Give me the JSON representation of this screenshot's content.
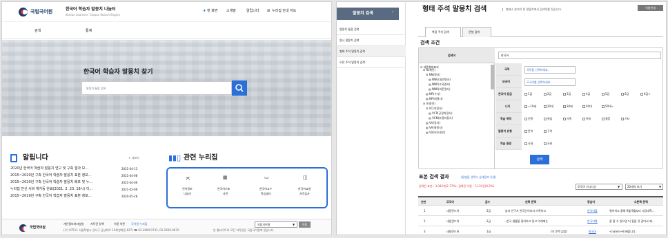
{
  "left": {
    "header": {
      "logo_text": "국립국어원",
      "site_title": "한국어 학습자 말뭉치 나눔터",
      "site_subtitle": "Korean Learners' Corpus Search Engine",
      "links": [
        "첫 화면",
        "소개말",
        "알립니다",
        "누리집 안내 지도"
      ]
    },
    "nav": {
      "items": [
        "검색",
        "통계"
      ]
    },
    "hero": {
      "title": "한국어 학습자 말뭉치 찾기",
      "search_placeholder": "말뭉치 통합 검색"
    },
    "notice": {
      "heading": "알립니다",
      "more": "+ 더보기",
      "items": [
        {
          "title": "2020년 한국어 학습자 말뭉치 연구 및 구축 결과 보...",
          "date": "2021-04-13"
        },
        {
          "title": "2015~2020년 구축 한국어 학습자 말뭉치 표본 정보...",
          "date": "2021-04-08"
        },
        {
          "title": "2015~2020년 구축 한국어 학습자 말뭉치 배포 및 누...",
          "date": "2021-04-06"
        },
        {
          "title": "누리집 전산 서버 재가동 완료(2021. 2. 23. 18시) 이...",
          "date": "2021-02-09"
        },
        {
          "title": "2015~2019년 구축 한국어 학습자 말뭉치 표본 정보...",
          "date": "2020-05-28"
        }
      ]
    },
    "related": {
      "heading": "관련 누리집",
      "tiles": [
        {
          "line1": "언어정보",
          "line2": "나눔터"
        },
        {
          "line1": "한국어기초",
          "line2": "사전"
        },
        {
          "line1": "한국어교수",
          "line2": "학습샘터"
        },
        {
          "line1": "한국어교원",
          "line2": "자격심사"
        }
      ]
    },
    "footer": {
      "logo_text": "국립국어원",
      "links": [
        "개인정보처리방침",
        "저작권 정책",
        "이용 약관",
        "국어원 누리집"
      ],
      "address": "(우) 07511 서울특별시 강서구 금낭화로 154(방화동 827)  ☎ 02-2669-9743, 02-2669-9670",
      "copyright": "본 웹사이트의 모든 저작권은 국립국어원에 있습니다.",
      "select": "국립국어원",
      "go": "이동"
    }
  },
  "right": {
    "sidebar": {
      "head": "말뭉치 검색",
      "items": [
        "말뭉치 통합 검색",
        "원시 말뭉치 검색",
        "형태 주석 말뭉치 검색",
        "오류 주석 말뭉치 검색"
      ]
    },
    "page": {
      "title": "형태 주석 말뭉치 검색",
      "desc": "형태소 분석이 된 말뭉치에서 검색어를 찾습니다.",
      "help": "이용안내"
    },
    "tabs": [
      "복합 주석 검색",
      "문형 검색"
    ],
    "cond": {
      "heading": "검색 조건",
      "keyword_label": "검색어",
      "keyword_value": "한국어",
      "tree": [
        "⊟ 세종형태표지",
        "⊟ N(체언)",
        "⊟ NN(명사)",
        "▤ NNG(일반명사)",
        "▤ NNP(고유명사)",
        "▤ NNB(의존명사)",
        "▤ NR(수사)",
        "▤ NP(대명사)",
        "⊟ V(용언)",
        "⊟ VC(지정사)",
        "▤ VCP(긍정지정사)",
        "▤ VCN(부정지정사)",
        "▤ VV(동사)",
        "▤ VA(형용사)",
        "▤ VX(보조용언)"
      ],
      "rows": [
        {
          "label": "국적",
          "value": "국적을 선택하세요."
        },
        {
          "label": "모국어",
          "value": "모국어를 선택하세요."
        },
        {
          "label": "한국어 등급",
          "opts": [
            "1급",
            "2급",
            "3급",
            "4급",
            "5급",
            "6급",
            "6급+"
          ]
        },
        {
          "label": "나이",
          "opts": [
            "~19세",
            "20대",
            "30대",
            "40대",
            "50대~"
          ]
        },
        {
          "label": "학습 목적",
          "opts": [
            "진학",
            "취업",
            "가족",
            "취미",
            "결혼",
            "기타"
          ]
        },
        {
          "label": "말뭉치 유형",
          "opts": [
            "문어",
            "구어"
          ]
        },
        {
          "label": "학습 환경",
          "opts": [
            "국내",
            "국외"
          ]
        }
      ],
      "submit": "검색"
    },
    "result": {
      "heading": "표본 검색 결과",
      "note": "(용법을 선택시 상세정보 유용)",
      "summary": "검색된 표본 : 3,042개(2.77%), 검색된 어절 : 7,134건(0.2%)",
      "filter": "모국어 가나다순",
      "pagesize": "20개씩 보기",
      "columns": [
        "연번",
        "모국어",
        "급수",
        "왼쪽 문맥",
        "중심어",
        "오른쪽 문맥"
      ],
      "rows": [
        {
          "no": "1",
          "lang": "네덜란드어",
          "grade": "2급",
          "left": "남자 친구가 한국인이라서 가족하고",
          "kw": "한국어를",
          "right": "열어하고 올해 9월 9월부터 서강대학..."
        },
        {
          "no": "2",
          "lang": "네덜란드어",
          "grade": "2급",
          "left": "...한국 생활을 좋아하고 있고 이래에는",
          "kw": "한국어를",
          "right": "잘 할 수 있으면 더 좋을 것 같아서 제..."
        },
        {
          "no": "3",
          "lang": "네덜란드어",
          "grade": "1급",
          "left": "(이 문맥 없음)",
          "kw": "한국어",
          "right": "<name>에 배웁니다."
        }
      ]
    }
  }
}
